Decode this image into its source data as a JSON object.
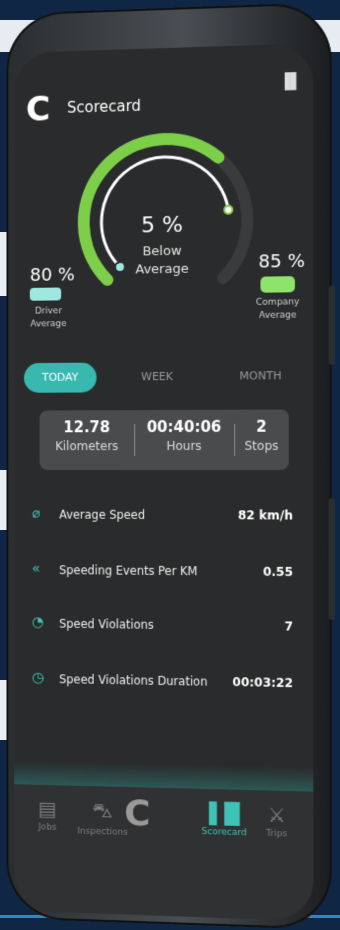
{
  "header": {
    "title": "Scorecard",
    "logo_glyph": "C",
    "chart_icon_glyph": "▐▌"
  },
  "gauge": {
    "value": "5 %",
    "label_line1": "Below",
    "label_line2": "Average",
    "outer_progress": 0.65,
    "inner_progress": 0.8,
    "colors": {
      "outer": "#7dcf4a",
      "inner": "#ffffff",
      "track": "#3a3b3c",
      "marker": "#9fe8e0"
    }
  },
  "driver": {
    "pct": "80 %",
    "label_line1": "Driver",
    "label_line2": "Average"
  },
  "company": {
    "pct": "85 %",
    "label_line1": "Company",
    "label_line2": "Average"
  },
  "tabs": [
    {
      "label": "TODAY",
      "active": true
    },
    {
      "label": "WEEK",
      "active": false
    },
    {
      "label": "MONTH",
      "active": false
    }
  ],
  "summary": [
    {
      "value": "12.78",
      "label": "Kilometers"
    },
    {
      "value": "00:40:06",
      "label": "Hours"
    },
    {
      "value": "2",
      "label": "Stops"
    }
  ],
  "metrics": [
    {
      "icon": "speed-icon",
      "glyph": "⌀",
      "label": "Average Speed",
      "value": "82  km/h"
    },
    {
      "icon": "speeding-events-icon",
      "glyph": "«",
      "label": "Speeding Events Per KM",
      "value": "0.55"
    },
    {
      "icon": "speedometer-icon",
      "glyph": "◔",
      "label": "Speed Violations",
      "value": "7"
    },
    {
      "icon": "stopwatch-icon",
      "glyph": "◷",
      "label": "Speed Violations Duration",
      "value": "00:03:22"
    }
  ],
  "nav": [
    {
      "label": "Jobs",
      "icon": "briefcase-icon",
      "glyph": "▤"
    },
    {
      "label": "Inspections",
      "icon": "inspection-icon",
      "glyph": "⛍"
    },
    {
      "label": "",
      "icon": "logo-icon",
      "glyph": "C"
    },
    {
      "label": "Scorecard",
      "icon": "bar-chart-icon",
      "glyph": "▐▐▌",
      "active": true
    },
    {
      "label": "Trips",
      "icon": "walking-icon",
      "glyph": "⚔"
    }
  ],
  "accent_color": "#39b8b0"
}
